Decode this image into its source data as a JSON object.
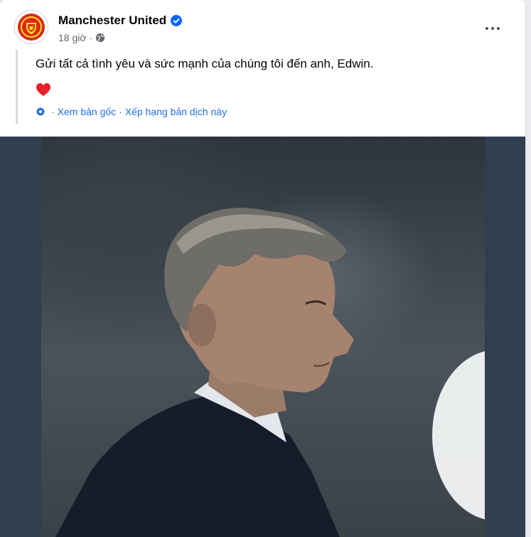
{
  "post": {
    "page_name": "Manchester United",
    "time": "18 giờ",
    "separator": "·",
    "text": "Gửi tất cả tình yêu và sức mạnh của chúng tôi đến anh, Edwin.",
    "emoji": "heart-icon",
    "translation": {
      "view_original": "Xem bản gốc",
      "rate_translation": "Xếp hạng bản dịch này",
      "dot": "·"
    }
  },
  "icons": {
    "verified": "verified-badge-icon",
    "privacy": "globe-icon",
    "more": "more-options-icon",
    "translate": "gear-icon"
  },
  "colors": {
    "accent": "#216fdb",
    "verified": "#0866ff",
    "muted": "#65676b",
    "media_bg": "#323e4e",
    "heart": "#e8202a"
  }
}
